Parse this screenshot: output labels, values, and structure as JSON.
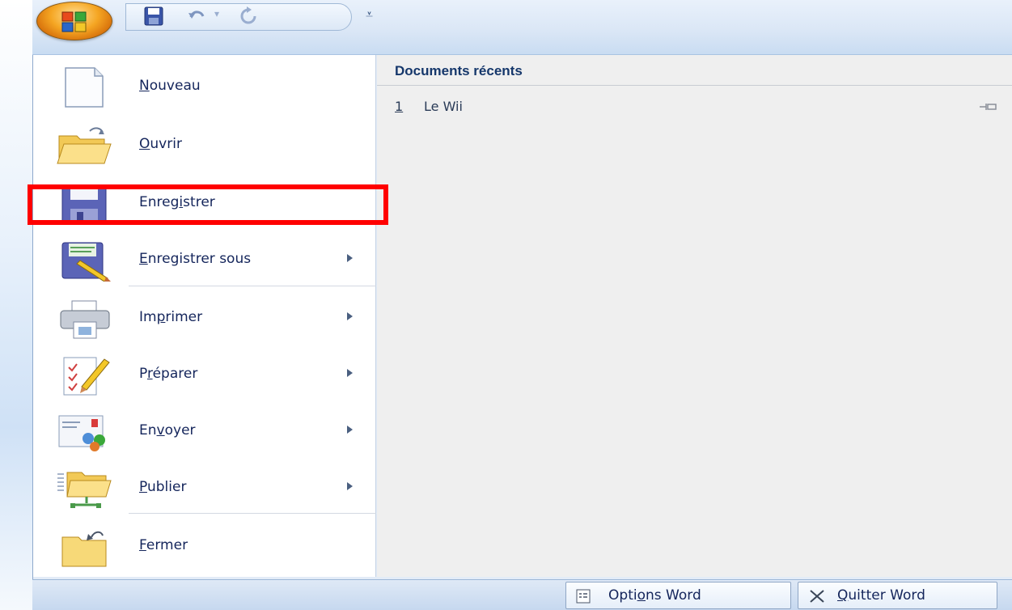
{
  "quick_access": {
    "save_icon": "save-icon",
    "undo_icon": "undo-icon",
    "redo_icon": "redo-icon",
    "customize_icon": "customize-dropdown-icon",
    "customize_glyph": "⩡"
  },
  "menu": {
    "items": [
      {
        "label": "Nouveau",
        "underline_index": 0,
        "icon": "new-document-icon",
        "has_submenu": false
      },
      {
        "label": "Ouvrir",
        "underline_index": 0,
        "icon": "open-folder-icon",
        "has_submenu": false
      },
      {
        "label": "Enregistrer",
        "underline_index": 5,
        "icon": "save-disk-icon",
        "has_submenu": false
      },
      {
        "label": "Enregistrer sous",
        "underline_index": 0,
        "icon": "save-as-icon",
        "has_submenu": true
      },
      {
        "label": "Imprimer",
        "underline_index": 2,
        "icon": "printer-icon",
        "has_submenu": true
      },
      {
        "label": "Préparer",
        "underline_index": 1,
        "icon": "prepare-icon",
        "has_submenu": true
      },
      {
        "label": "Envoyer",
        "underline_index": 2,
        "icon": "send-icon",
        "has_submenu": true
      },
      {
        "label": "Publier",
        "underline_index": 0,
        "icon": "publish-icon",
        "has_submenu": true
      },
      {
        "label": "Fermer",
        "underline_index": 0,
        "icon": "close-folder-icon",
        "has_submenu": false
      }
    ]
  },
  "recent": {
    "title": "Documents récents",
    "items": [
      {
        "number": "1",
        "name": "Le Wii"
      }
    ]
  },
  "bottom": {
    "options_label": "Options Word",
    "options_underline_index": 4,
    "quit_label": "Quitter Word",
    "quit_underline_index": 0
  },
  "colors": {
    "highlight": "#ff0000",
    "label_text": "#14255b",
    "title_text": "#15376b"
  }
}
